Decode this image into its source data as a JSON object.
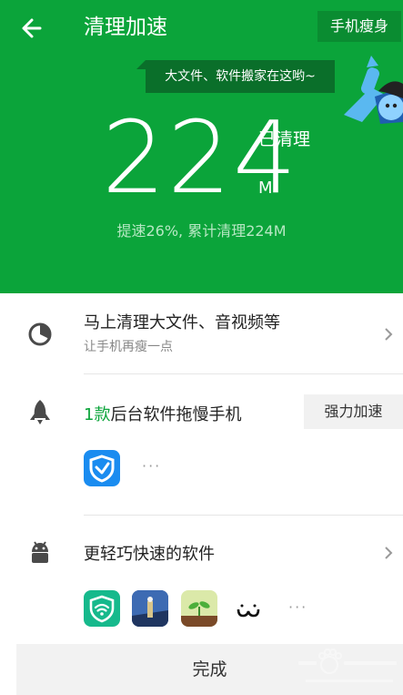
{
  "header": {
    "title": "清理加速",
    "slim_button": "手机瘦身",
    "tooltip": "大文件、软件搬家在这哟~",
    "cleaned_amount": "224",
    "cleaned_label": "已清理",
    "unit": "M",
    "summary": "提速26%, 累计清理224M"
  },
  "rows": {
    "large_files": {
      "title": "马上清理大文件、音视频等",
      "subtitle": "让手机再瘦一点"
    },
    "background": {
      "count": "1款",
      "title_rest": "后台软件拖慢手机",
      "action": "强力加速",
      "more": "···"
    },
    "lighter": {
      "title": "更轻巧快速的软件",
      "more": "···"
    }
  },
  "footer": {
    "done": "完成"
  },
  "colors": {
    "brand_green": "#0ba43a",
    "header_dark": "#0a8c31"
  }
}
